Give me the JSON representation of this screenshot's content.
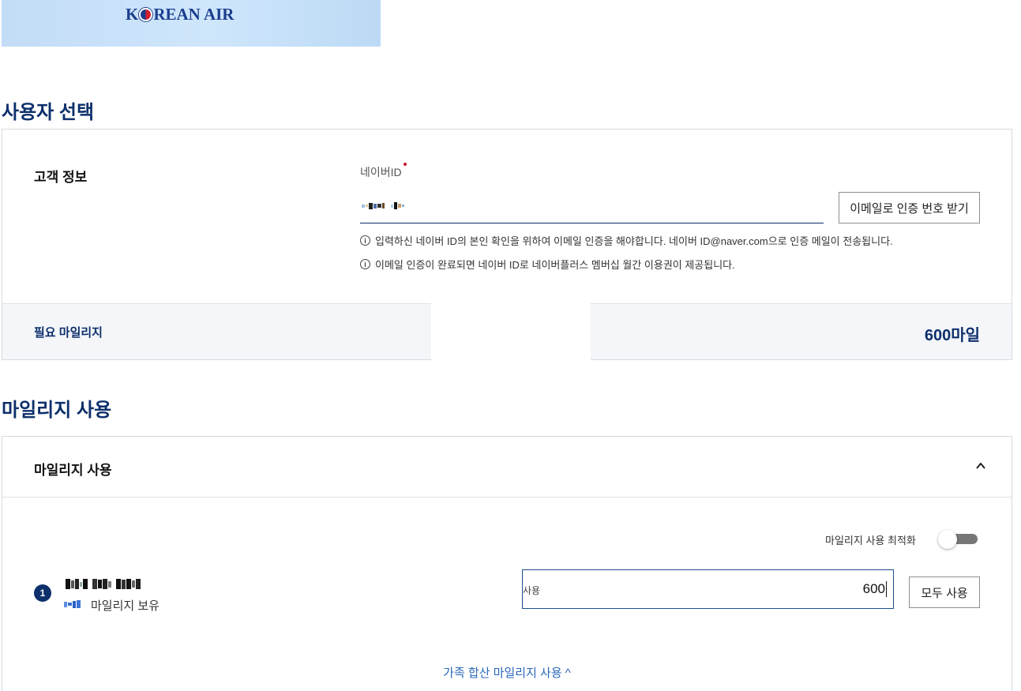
{
  "banner": {
    "logo_text_left": "K",
    "logo_text_right": "REAN AIR",
    "brand_color": "#1b3e8f"
  },
  "user_select": {
    "section_title": "사용자 선택",
    "customer_info_label": "고객 정보",
    "naver_id_label": "네이버ID",
    "naver_id_value": "",
    "email_auth_button": "이메일로 인증 번호 받기",
    "info_1": "입력하신 네이버 ID의 본인 확인을 위하여 이메일 인증을 해야합니다. 네이버 ID@naver.com으로 인증 메일이 전송됩니다.",
    "info_2": "이메일 인증이 완료되면 네이버 ID로 네이버플러스 멤버십 월간 이용권이 제공됩니다.",
    "required_mileage_label": "필요 마일리지",
    "required_mileage_value": "600마일"
  },
  "mileage_use": {
    "section_title": "마일리지 사용",
    "panel_title": "마일리지 사용",
    "optimize_label": "마일리지 사용 최적화",
    "optimize_enabled": false,
    "member_index": "1",
    "holding_label": "마일리지 보유",
    "use_label": "사용",
    "use_value": "600",
    "use_all_button": "모두 사용",
    "family_link": "가족 합산 마일리지 사용 ^"
  },
  "icons": {
    "info": "info-circle-icon",
    "chevron": "chevron-up-icon"
  },
  "colors": {
    "navy": "#0d2f6b",
    "link": "#2a67b8",
    "required": "#c7102e"
  }
}
